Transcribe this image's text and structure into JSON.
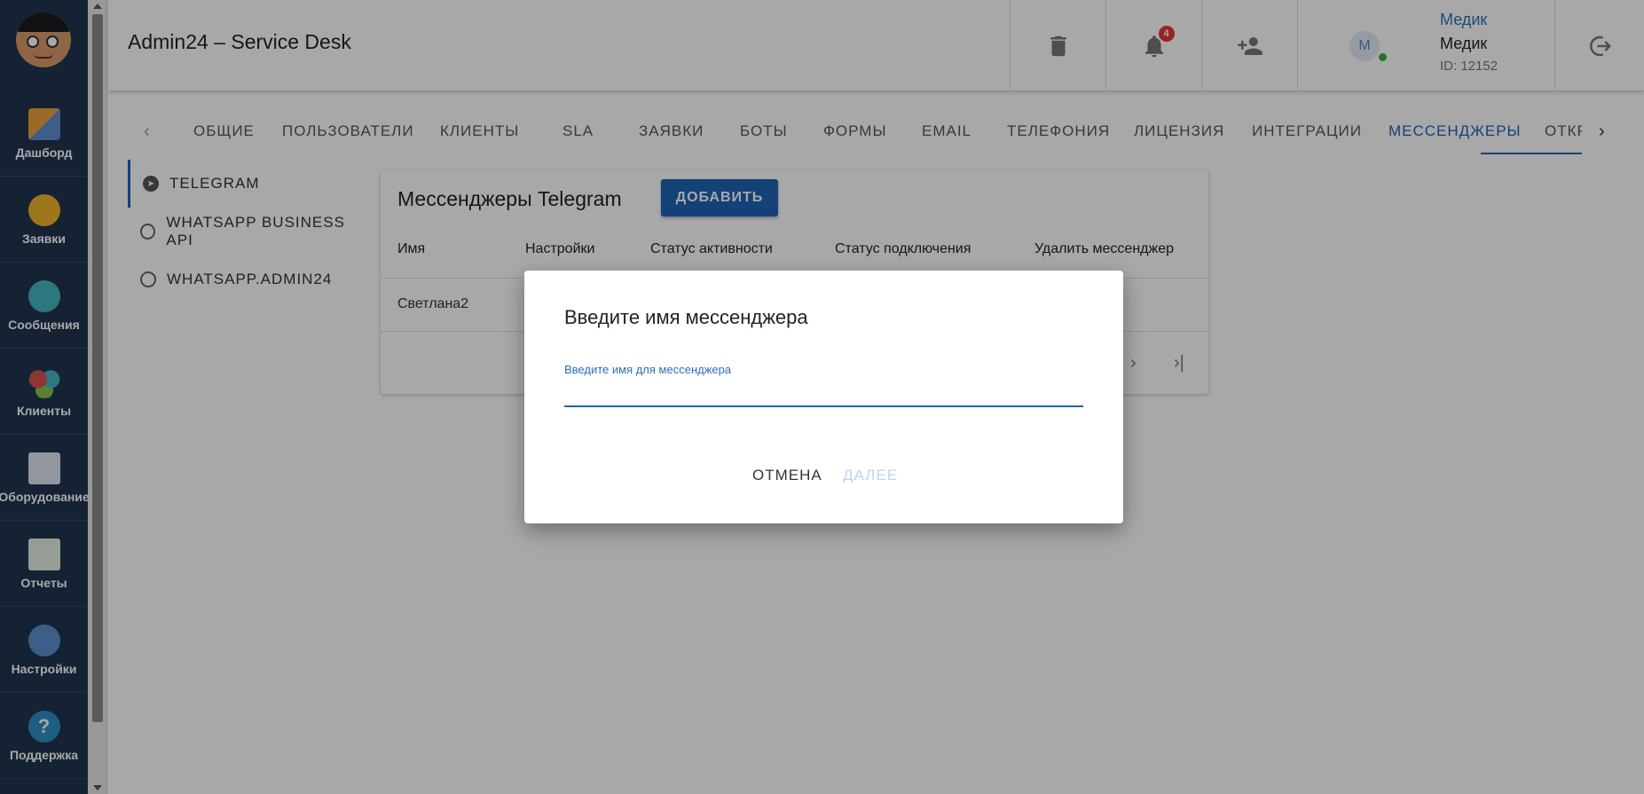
{
  "sidebar": {
    "items": [
      {
        "label": "Дашборд",
        "icon": "dashboard-icon",
        "color": "#e8a33c"
      },
      {
        "label": "Заявки",
        "icon": "megaphone-icon",
        "color": "#f0b429"
      },
      {
        "label": "Сообщения",
        "icon": "chat-icon",
        "color": "#45b5c4"
      },
      {
        "label": "Клиенты",
        "icon": "clients-icon",
        "color": "#d9534f"
      },
      {
        "label": "Оборудование",
        "icon": "equipment-icon",
        "color": "#8bc34a"
      },
      {
        "label": "Отчеты",
        "icon": "reports-icon",
        "color": "#66bb6a"
      },
      {
        "label": "Настройки",
        "icon": "settings-gear-icon",
        "color": "#5b8fcf"
      },
      {
        "label": "Поддержка",
        "icon": "help-icon",
        "color": "#2d8fc6"
      }
    ]
  },
  "header": {
    "title": "Admin24 – Service Desk",
    "notifications_count": "4",
    "user": {
      "avatar_letter": "М",
      "name_link": "Медик",
      "name": "Медик",
      "id_text": "ID: 12152"
    }
  },
  "tabs": [
    {
      "label": "ОБЩИЕ"
    },
    {
      "label": "ПОЛЬЗОВАТЕЛИ"
    },
    {
      "label": "КЛИЕНТЫ"
    },
    {
      "label": "SLA"
    },
    {
      "label": "ЗАЯВКИ"
    },
    {
      "label": "БОТЫ"
    },
    {
      "label": "ФОРМЫ"
    },
    {
      "label": "EMAIL"
    },
    {
      "label": "ТЕЛЕФОНИЯ"
    },
    {
      "label": "ЛИЦЕНЗИЯ"
    },
    {
      "label": "ИНТЕГРАЦИИ"
    },
    {
      "label": "МЕССЕНДЖЕРЫ"
    },
    {
      "label": "ОТКР"
    }
  ],
  "active_tab": "МЕССЕНДЖЕРЫ",
  "submenu": [
    {
      "label": "TELEGRAM",
      "icon": "telegram-icon"
    },
    {
      "label": "WHATSAPP BUSINESS API",
      "icon": "whatsapp-icon"
    },
    {
      "label": "WHATSAPP.ADMIN24",
      "icon": "whatsapp-icon"
    }
  ],
  "card": {
    "title": "Мессенджеры Telegram",
    "add_label": "ДОБАВИТЬ",
    "columns": [
      "Имя",
      "Настройки",
      "Статус активности",
      "Статус подключения",
      "Удалить мессенджер"
    ],
    "rows": [
      [
        "Светлана2"
      ]
    ]
  },
  "dialog": {
    "title": "Введите имя мессенджера",
    "field_label": "Введите имя для мессенджера",
    "field_value": "",
    "cancel_label": "ОТМЕНА",
    "next_label": "ДАЛЕЕ"
  },
  "colors": {
    "sidebar_bg": "#1f3550",
    "accent": "#1d63b6",
    "badge": "#e53935"
  }
}
